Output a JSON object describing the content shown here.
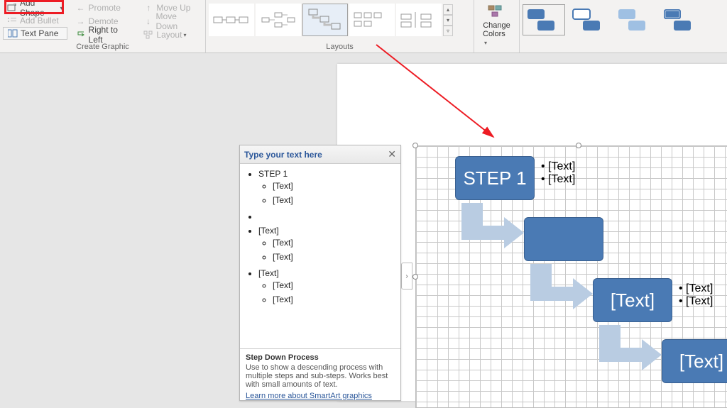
{
  "ribbon": {
    "add_shape": "Add Shape",
    "add_bullet": "Add Bullet",
    "text_pane": "Text Pane",
    "promote": "Promote",
    "demote": "Demote",
    "right_to_left": "Right to Left",
    "move_up": "Move Up",
    "move_down": "Move Down",
    "layout": "Layout",
    "group_create": "Create Graphic",
    "group_layouts": "Layouts",
    "change_colors": "Change",
    "change_colors2": "Colors"
  },
  "textpane": {
    "title": "Type your text here",
    "items": [
      {
        "label": "STEP 1",
        "children": [
          "[Text]",
          "[Text]"
        ]
      },
      {
        "label": "",
        "children": []
      },
      {
        "label": "[Text]",
        "children": [
          "[Text]",
          "[Text]"
        ]
      },
      {
        "label": "[Text]",
        "children": [
          "[Text]",
          "[Text]"
        ]
      }
    ],
    "hint_title": "Step Down Process",
    "hint_body": "Use to show a descending process with multiple steps and sub-steps. Works best with small amounts of text.",
    "hint_link": "Learn more about SmartArt graphics"
  },
  "smartart": {
    "s1": "STEP 1",
    "s1_b1": "[Text]",
    "s1_b2": "[Text]",
    "s3": "[Text]",
    "s3_b1": "[Text]",
    "s3_b2": "[Text]",
    "s4": "[Text]"
  },
  "colors": {
    "shape": "#4a7ab4",
    "arrow": "#b9cce2"
  }
}
